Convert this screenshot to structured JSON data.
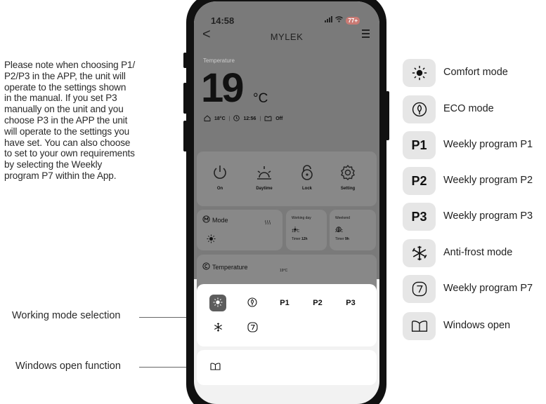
{
  "note": {
    "lines": [
      "Please note when choosing P1/",
      "P2/P3 in the APP, the unit will",
      "operate to the settings shown",
      "in the manual. If you set P3",
      "manually on the unit and you",
      "choose P3 in the APP the unit",
      "will operate to the settings you",
      "have set. You can also choose",
      "to set to your own requirements",
      "by selecting the Weekly",
      "program P7 within the App."
    ]
  },
  "callouts": {
    "working_mode": "Working mode selection",
    "windows_open": "Windows open function"
  },
  "phone": {
    "status": {
      "time": "14:58",
      "battery": "77+"
    },
    "title": "MYLEK",
    "temperature": {
      "label": "Temperature",
      "value": "19",
      "unit": "°C",
      "room_temp": "18°C",
      "timer": "12:56",
      "window": "Off"
    },
    "controls": [
      {
        "label": "On",
        "icon": "power-icon"
      },
      {
        "label": "Daytime",
        "icon": "sunrise-icon"
      },
      {
        "label": "Lock",
        "icon": "lock-icon"
      },
      {
        "label": "Setting",
        "icon": "gear-icon"
      }
    ],
    "mode_card": {
      "title": "Mode"
    },
    "working_day": {
      "title": "Working day",
      "temp": "19°C",
      "timer_label": "Timer",
      "timer_value": "12h"
    },
    "weekend": {
      "title": "Weekend",
      "temp": "21°C",
      "timer_label": "Timer",
      "timer_value": "9h"
    },
    "temperature_card": {
      "title": "Temperature",
      "value": "19°C"
    },
    "mode_buttons": [
      {
        "id": "comfort",
        "label": "",
        "icon": "sun-icon",
        "active": true
      },
      {
        "id": "eco",
        "label": "",
        "icon": "leaf-icon",
        "active": false
      },
      {
        "id": "p1",
        "label": "P1",
        "active": false
      },
      {
        "id": "p2",
        "label": "P2",
        "active": false
      },
      {
        "id": "p3",
        "label": "P3",
        "active": false
      },
      {
        "id": "antifrost",
        "label": "",
        "icon": "snowflake-icon",
        "active": false
      },
      {
        "id": "p7",
        "label": "",
        "icon": "seven-icon",
        "active": false
      }
    ],
    "window_button": {
      "icon": "window-icon"
    }
  },
  "legend": [
    {
      "icon": "sun-icon",
      "text": "",
      "label": "Comfort mode"
    },
    {
      "icon": "leaf-icon",
      "text": "",
      "label": "ECO mode"
    },
    {
      "icon": "p1",
      "text": "P1",
      "label": "Weekly program P1"
    },
    {
      "icon": "p2",
      "text": "P2",
      "label": "Weekly program P2"
    },
    {
      "icon": "p3",
      "text": "P3",
      "label": "Weekly program P3"
    },
    {
      "icon": "snowflake-icon",
      "text": "",
      "label": "Anti-frost mode"
    },
    {
      "icon": "seven-icon",
      "text": "",
      "label": "Weekly program P7"
    },
    {
      "icon": "window-icon",
      "text": "",
      "label": "Windows open"
    }
  ],
  "colors": {
    "dim_overlay": "#7a7a7a",
    "active_mode": "#5d5d5d",
    "legend_bg": "#e6e6e6"
  }
}
